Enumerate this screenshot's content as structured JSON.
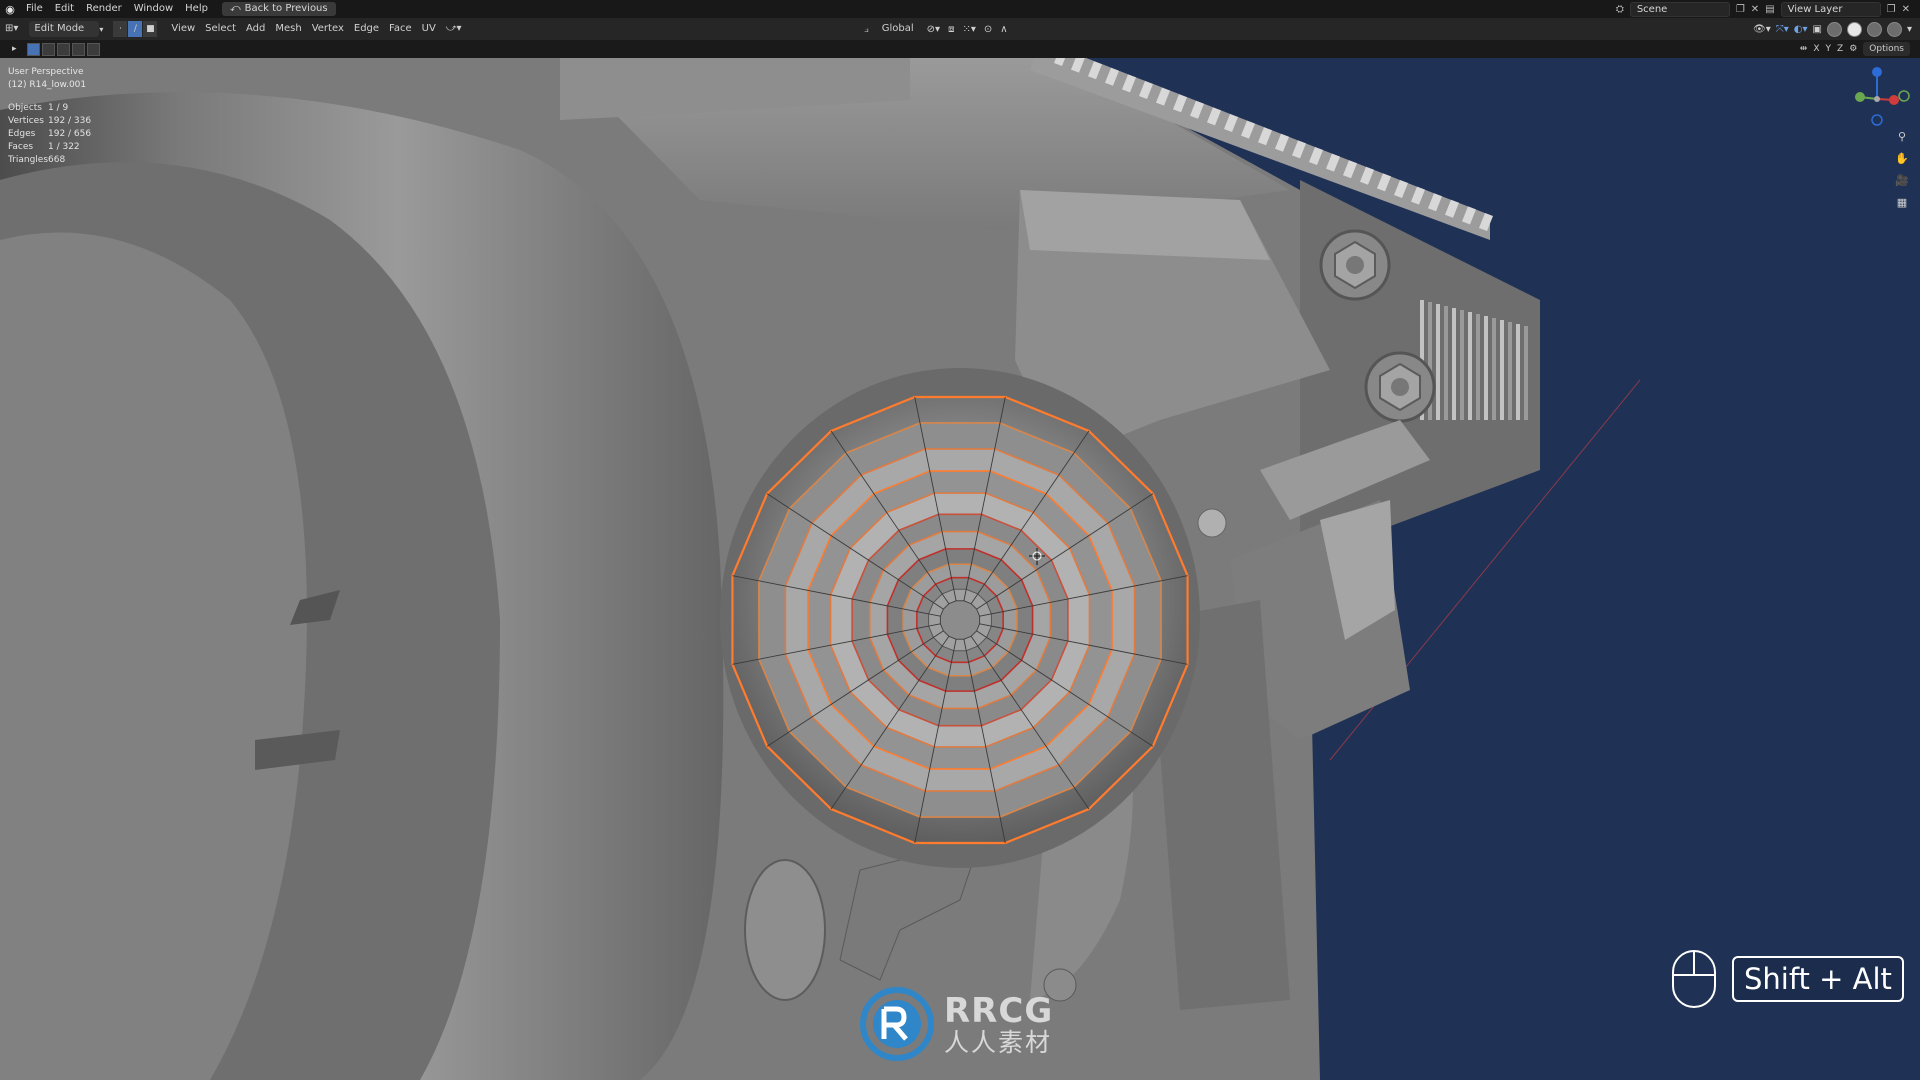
{
  "topbar": {
    "menu": [
      "File",
      "Edit",
      "Render",
      "Window",
      "Help"
    ],
    "back_button": "Back to Previous",
    "scene": "Scene",
    "view_layer": "View Layer"
  },
  "viewport_header": {
    "mode": "Edit Mode",
    "menus": [
      "View",
      "Select",
      "Add",
      "Mesh",
      "Vertex",
      "Edge",
      "Face",
      "UV"
    ],
    "transform_orientation": "Global"
  },
  "toolbar2": {
    "axes": [
      "X",
      "Y",
      "Z"
    ],
    "options": "Options"
  },
  "overlay": {
    "view_name": "User Perspective",
    "object_name": "(12) R14_low.001",
    "stats": [
      {
        "label": "Objects",
        "value": "1 / 9"
      },
      {
        "label": "Vertices",
        "value": "192 / 336"
      },
      {
        "label": "Edges",
        "value": "192 / 656"
      },
      {
        "label": "Faces",
        "value": "1 / 322"
      },
      {
        "label": "Triangles",
        "value": "668"
      }
    ]
  },
  "key_hint": "Shift + Alt",
  "watermark": {
    "en": "RRCG",
    "cn": "人人素材"
  },
  "colors": {
    "viewport_bg": "#1f3155",
    "mesh_gray": "#8a8a8a",
    "selection_orange": "#ff7b2e",
    "edge_red": "#c0302a",
    "accent_blue": "#4772b3"
  }
}
